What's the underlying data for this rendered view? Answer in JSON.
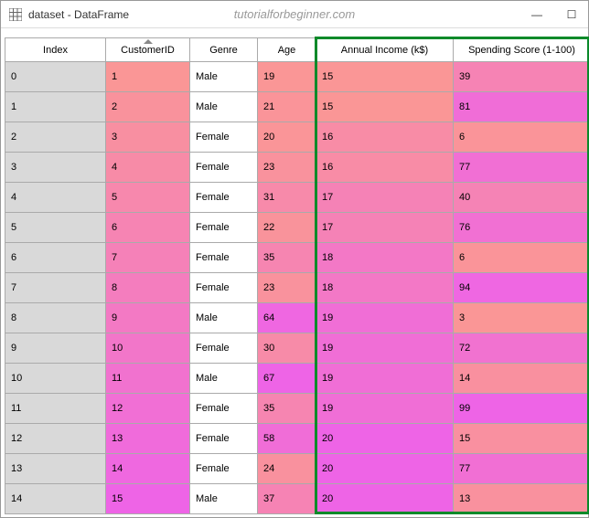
{
  "window": {
    "title": "dataset - DataFrame",
    "watermark": "tutorialforbeginner.com",
    "controls": {
      "minimize": "—",
      "maximize": "☐",
      "close": "✕"
    }
  },
  "table": {
    "columns": [
      "Index",
      "CustomerID",
      "Genre",
      "Age",
      "Annual Income (k$)",
      "Spending Score (1-100)"
    ],
    "rows": [
      {
        "Index": "0",
        "CustomerID": "1",
        "Genre": "Male",
        "Age": "19",
        "Annual Income (k$)": "15",
        "Spending Score (1-100)": "39"
      },
      {
        "Index": "1",
        "CustomerID": "2",
        "Genre": "Male",
        "Age": "21",
        "Annual Income (k$)": "15",
        "Spending Score (1-100)": "81"
      },
      {
        "Index": "2",
        "CustomerID": "3",
        "Genre": "Female",
        "Age": "20",
        "Annual Income (k$)": "16",
        "Spending Score (1-100)": "6"
      },
      {
        "Index": "3",
        "CustomerID": "4",
        "Genre": "Female",
        "Age": "23",
        "Annual Income (k$)": "16",
        "Spending Score (1-100)": "77"
      },
      {
        "Index": "4",
        "CustomerID": "5",
        "Genre": "Female",
        "Age": "31",
        "Annual Income (k$)": "17",
        "Spending Score (1-100)": "40"
      },
      {
        "Index": "5",
        "CustomerID": "6",
        "Genre": "Female",
        "Age": "22",
        "Annual Income (k$)": "17",
        "Spending Score (1-100)": "76"
      },
      {
        "Index": "6",
        "CustomerID": "7",
        "Genre": "Female",
        "Age": "35",
        "Annual Income (k$)": "18",
        "Spending Score (1-100)": "6"
      },
      {
        "Index": "7",
        "CustomerID": "8",
        "Genre": "Female",
        "Age": "23",
        "Annual Income (k$)": "18",
        "Spending Score (1-100)": "94"
      },
      {
        "Index": "8",
        "CustomerID": "9",
        "Genre": "Male",
        "Age": "64",
        "Annual Income (k$)": "19",
        "Spending Score (1-100)": "3"
      },
      {
        "Index": "9",
        "CustomerID": "10",
        "Genre": "Female",
        "Age": "30",
        "Annual Income (k$)": "19",
        "Spending Score (1-100)": "72"
      },
      {
        "Index": "10",
        "CustomerID": "11",
        "Genre": "Male",
        "Age": "67",
        "Annual Income (k$)": "19",
        "Spending Score (1-100)": "14"
      },
      {
        "Index": "11",
        "CustomerID": "12",
        "Genre": "Female",
        "Age": "35",
        "Annual Income (k$)": "19",
        "Spending Score (1-100)": "99"
      },
      {
        "Index": "12",
        "CustomerID": "13",
        "Genre": "Female",
        "Age": "58",
        "Annual Income (k$)": "20",
        "Spending Score (1-100)": "15"
      },
      {
        "Index": "13",
        "CustomerID": "14",
        "Genre": "Female",
        "Age": "24",
        "Annual Income (k$)": "20",
        "Spending Score (1-100)": "77"
      },
      {
        "Index": "14",
        "CustomerID": "15",
        "Genre": "Male",
        "Age": "37",
        "Annual Income (k$)": "20",
        "Spending Score (1-100)": "13"
      }
    ],
    "heat": {
      "CustomerID": {
        "min": 1,
        "max": 15
      },
      "Age": {
        "min": 19,
        "max": 67
      },
      "Annual Income (k$)": {
        "min": 15,
        "max": 20
      },
      "Spending Score (1-100)": {
        "min": 3,
        "max": 99
      }
    }
  }
}
